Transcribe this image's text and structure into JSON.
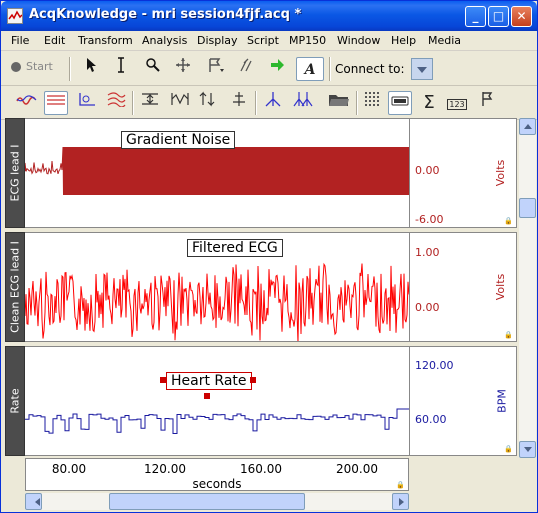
{
  "window": {
    "title": "AcqKnowledge - mri session4fjf.acq *",
    "controls": {
      "minimize": "_",
      "maximize": "□",
      "close": "✕"
    }
  },
  "menu": [
    "File",
    "Edit",
    "Transform",
    "Analysis",
    "Display",
    "Script",
    "MP150",
    "Window",
    "Help",
    "Media"
  ],
  "toolbar1": {
    "start_label": "Start",
    "connect_label": "Connect to:",
    "tools": [
      "arrow-cursor-icon",
      "i-beam-icon",
      "zoom-icon",
      "move-icon",
      "flag-icon",
      "multi-flag-icon",
      "green-arrow-icon",
      "text-tool-icon"
    ]
  },
  "toolbar2": {
    "tools": [
      "overlap-icon",
      "overlay-icon",
      "scale-icon",
      "stack-icon",
      "autoscale-horizontal-icon",
      "autoscale-waveform-icon",
      "scale-icon-2",
      "scale-icon-3",
      "marker-icon",
      "markers-icon",
      "open-icon",
      "grid-icon",
      "channel-icon",
      "sigma-icon",
      "measurement-icon",
      "flag-icon"
    ],
    "sigma_glyph": "Σ",
    "meas_glyph": "123"
  },
  "channels": [
    {
      "name": "ECG lead I",
      "annotation": "Gradient Noise",
      "scale_values": [
        "0.00",
        "-6.00"
      ],
      "unit": "Volts",
      "color": "#b22222"
    },
    {
      "name": "Clean ECG lead I",
      "annotation": "Filtered ECG",
      "scale_values": [
        "1.00",
        "0.00"
      ],
      "unit": "Volts",
      "color": "#ff0000"
    },
    {
      "name": "Rate",
      "annotation": "Heart Rate",
      "scale_values": [
        "120.00",
        "60.00"
      ],
      "unit": "BPM",
      "color": "#1a1aa0"
    }
  ],
  "xaxis": {
    "ticks": [
      "80.00",
      "120.00",
      "160.00",
      "200.00"
    ],
    "label": "seconds"
  }
}
